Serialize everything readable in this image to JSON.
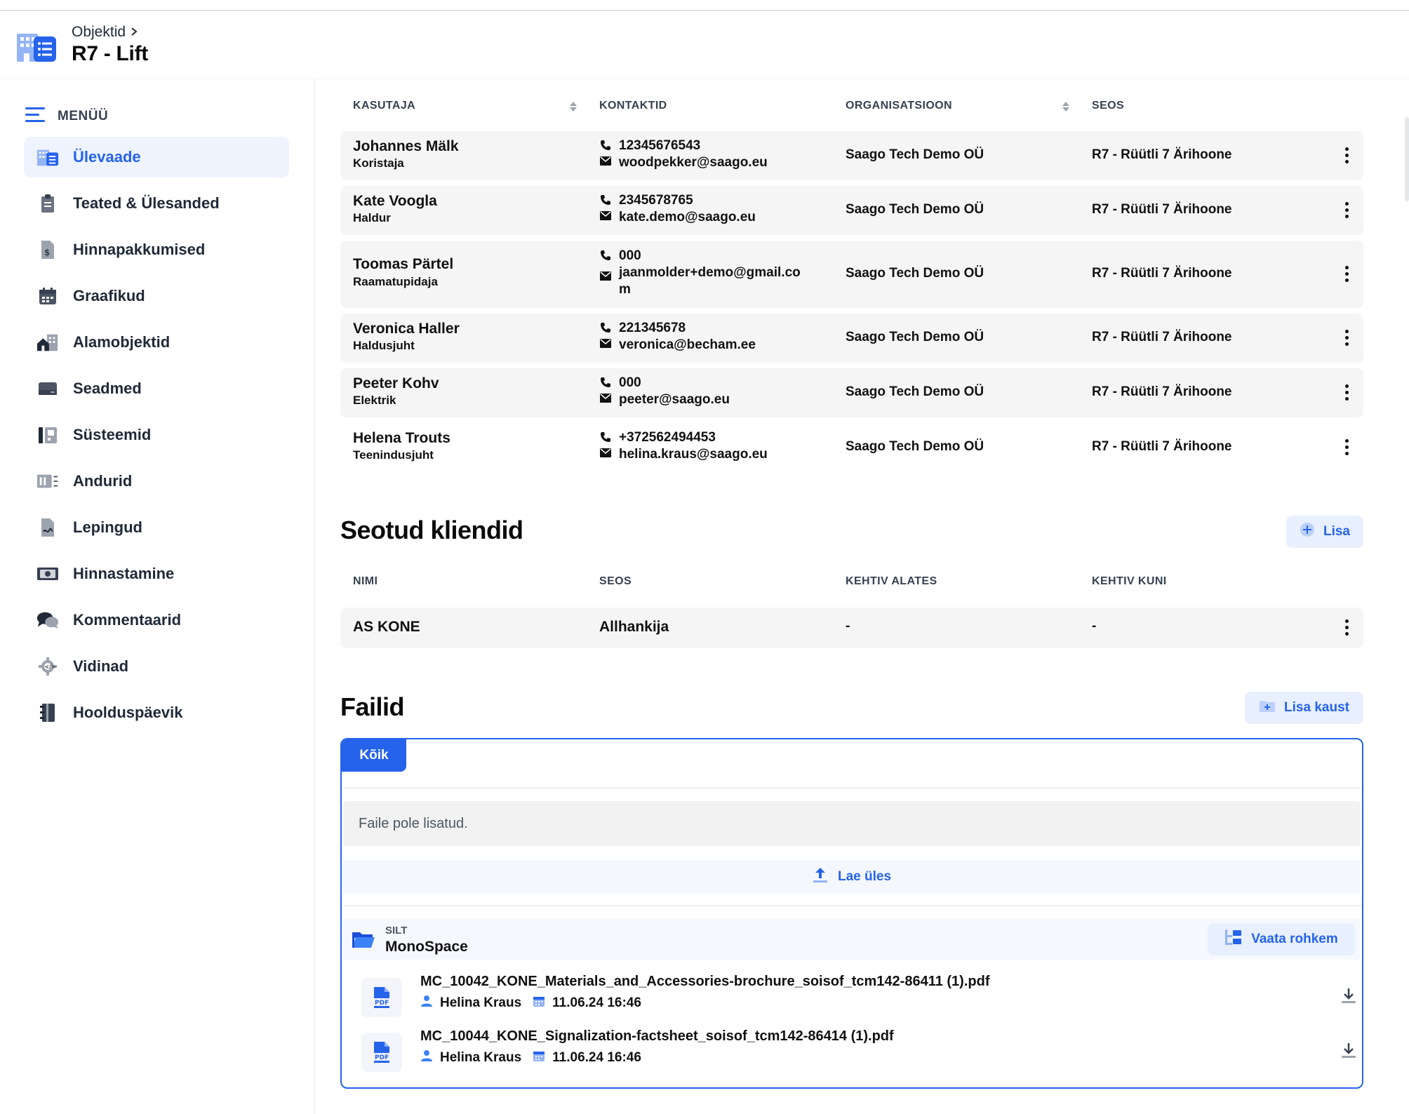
{
  "colors": {
    "accent": "#2563eb",
    "accent_light": "#e8efff"
  },
  "header": {
    "breadcrumb": "Objektid",
    "title": "R7 - Lift"
  },
  "sidebar": {
    "menu_label": "MENÜÜ",
    "items": [
      {
        "label": "Ülevaade",
        "icon": "building-icon",
        "active": true
      },
      {
        "label": "Teated & Ülesanded",
        "icon": "clipboard-icon"
      },
      {
        "label": "Hinnapakkumised",
        "icon": "price-document-icon"
      },
      {
        "label": "Graafikud",
        "icon": "calendar-icon"
      },
      {
        "label": "Alamobjektid",
        "icon": "buildings-icon"
      },
      {
        "label": "Seadmed",
        "icon": "device-icon"
      },
      {
        "label": "Süsteemid",
        "icon": "system-icon"
      },
      {
        "label": "Andurid",
        "icon": "sensor-icon"
      },
      {
        "label": "Lepingud",
        "icon": "contract-icon"
      },
      {
        "label": "Hinnastamine",
        "icon": "money-icon"
      },
      {
        "label": "Kommentaarid",
        "icon": "comments-icon"
      },
      {
        "label": "Vidinad",
        "icon": "widget-gear-icon"
      },
      {
        "label": "Hoolduspäevik",
        "icon": "logbook-icon"
      }
    ]
  },
  "users_table": {
    "headers": {
      "user": "KASUTAJA",
      "contacts": "KONTAKTID",
      "org": "ORGANISATSIOON",
      "relation": "SEOS"
    },
    "rows": [
      {
        "name": "Johannes Mälk",
        "role": "Koristaja",
        "phone": "12345676543",
        "email": "woodpekker@saago.eu",
        "org": "Saago Tech Demo OÜ",
        "relation": "R7 - Rüütli 7 Ärihoone"
      },
      {
        "name": "Kate Voogla",
        "role": "Haldur",
        "phone": "2345678765",
        "email": "kate.demo@saago.eu",
        "org": "Saago Tech Demo OÜ",
        "relation": "R7 - Rüütli 7 Ärihoone"
      },
      {
        "name": "Toomas Pärtel",
        "role": "Raamatupidaja",
        "phone": "000",
        "email": "jaanmolder+demo@gmail.co",
        "email2": "m",
        "org": "Saago Tech Demo OÜ",
        "relation": "R7 - Rüütli 7 Ärihoone"
      },
      {
        "name": "Veronica Haller",
        "role": "Haldusjuht",
        "phone": "221345678",
        "email": "veronica@becham.ee",
        "org": "Saago Tech Demo OÜ",
        "relation": "R7 - Rüütli 7 Ärihoone"
      },
      {
        "name": "Peeter Kohv",
        "role": "Elektrik",
        "phone": "000",
        "email": "peeter@saago.eu",
        "org": "Saago Tech Demo OÜ",
        "relation": "R7 - Rüütli 7 Ärihoone"
      },
      {
        "name": "Helena Trouts",
        "role": "Teenindusjuht",
        "phone": "+372562494453",
        "email": "helina.kraus@saago.eu",
        "org": "Saago Tech Demo OÜ",
        "relation": "R7 - Rüütli 7 Ärihoone"
      }
    ]
  },
  "clients": {
    "title": "Seotud kliendid",
    "add_label": "Lisa",
    "headers": {
      "name": "NIMI",
      "relation": "SEOS",
      "valid_from": "KEHTIV ALATES",
      "valid_to": "KEHTIV KUNI"
    },
    "rows": [
      {
        "name": "AS KONE",
        "relation": "Allhankija",
        "valid_from": "-",
        "valid_to": "-"
      }
    ]
  },
  "files": {
    "title": "Failid",
    "add_folder_label": "Lisa kaust",
    "tab_all": "Kõik",
    "empty_text": "Faile pole lisatud.",
    "upload_label": "Lae üles",
    "folder": {
      "label": "SILT",
      "name": "MonoSpace",
      "more_label": "Vaata rohkem"
    },
    "items": [
      {
        "name": "MC_10042_KONE_Materials_and_Accessories-brochure_soisof_tcm142-86411 (1).pdf",
        "author": "Helina Kraus",
        "date": "11.06.24 16:46",
        "badge": "PDF"
      },
      {
        "name": "MC_10044_KONE_Signalization-factsheet_soisof_tcm142-86414 (1).pdf",
        "author": "Helina Kraus",
        "date": "11.06.24 16:46",
        "badge": "PDF"
      }
    ]
  }
}
